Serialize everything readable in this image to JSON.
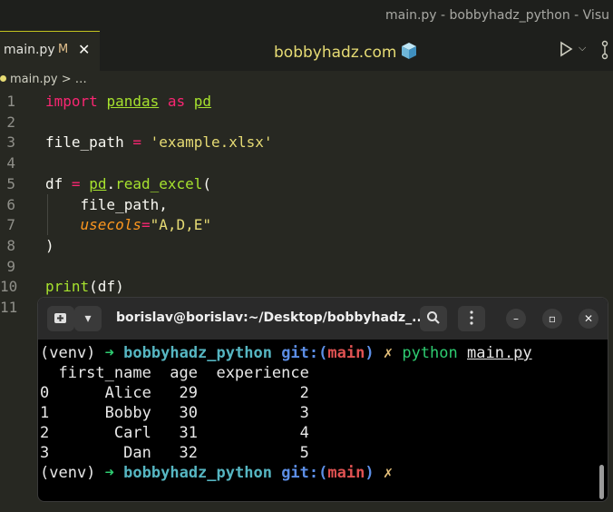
{
  "window": {
    "title": "main.py - bobbyhadz_python - Visu"
  },
  "tab": {
    "name": "main.py",
    "modified": "M",
    "close": "✕"
  },
  "header": {
    "center_title": "bobbyhadz.com"
  },
  "breadcrumb": {
    "file": "main.py",
    "sep": " > ",
    "rest": "…"
  },
  "editor": {
    "lines": [
      {
        "n": "1",
        "tokens": [
          [
            "kw",
            "import"
          ],
          [
            "plain",
            " "
          ],
          [
            "ns2",
            "pandas"
          ],
          [
            "plain",
            " "
          ],
          [
            "kw",
            "as"
          ],
          [
            "plain",
            " "
          ],
          [
            "ns2",
            "pd"
          ]
        ]
      },
      {
        "n": "2",
        "tokens": []
      },
      {
        "n": "3",
        "tokens": [
          [
            "plain",
            "file_path "
          ],
          [
            "kw",
            "="
          ],
          [
            "plain",
            " "
          ],
          [
            "str",
            "'example.xlsx'"
          ]
        ]
      },
      {
        "n": "4",
        "tokens": []
      },
      {
        "n": "5",
        "tokens": [
          [
            "plain",
            "df "
          ],
          [
            "kw",
            "="
          ],
          [
            "plain",
            " "
          ],
          [
            "ns2",
            "pd"
          ],
          [
            "plain",
            "."
          ],
          [
            "fn",
            "read_excel"
          ],
          [
            "plain",
            "("
          ]
        ]
      },
      {
        "n": "6",
        "tokens": [
          [
            "plain",
            "    file_path,"
          ]
        ]
      },
      {
        "n": "7",
        "tokens": [
          [
            "plain",
            "    "
          ],
          [
            "param",
            "usecols"
          ],
          [
            "kw",
            "="
          ],
          [
            "str",
            "\"A,D,E\""
          ]
        ]
      },
      {
        "n": "8",
        "tokens": [
          [
            "plain",
            ")"
          ]
        ]
      },
      {
        "n": "9",
        "tokens": []
      },
      {
        "n": "10",
        "tokens": [
          [
            "fn",
            "print"
          ],
          [
            "plain",
            "(df)"
          ]
        ]
      },
      {
        "n": "11",
        "tokens": []
      }
    ]
  },
  "terminal": {
    "title": "borislav@borislav:~/Desktop/bobbyhadz_...",
    "prompt": {
      "venv": "(venv)",
      "arrow": "➜",
      "dir": "bobbyhadz_python",
      "git": "git:(",
      "branch": "main",
      "git_close": ")",
      "x": "✗",
      "cmd": "python",
      "arg": "main.py"
    },
    "output": [
      "  first_name  age  experience",
      "0      Alice   29           2",
      "1      Bobby   30           3",
      "2       Carl   31           4",
      "3        Dan   32           5"
    ]
  },
  "colors": {
    "accent": "#e6db74",
    "background": "#272822",
    "terminal_bg": "#000000"
  }
}
